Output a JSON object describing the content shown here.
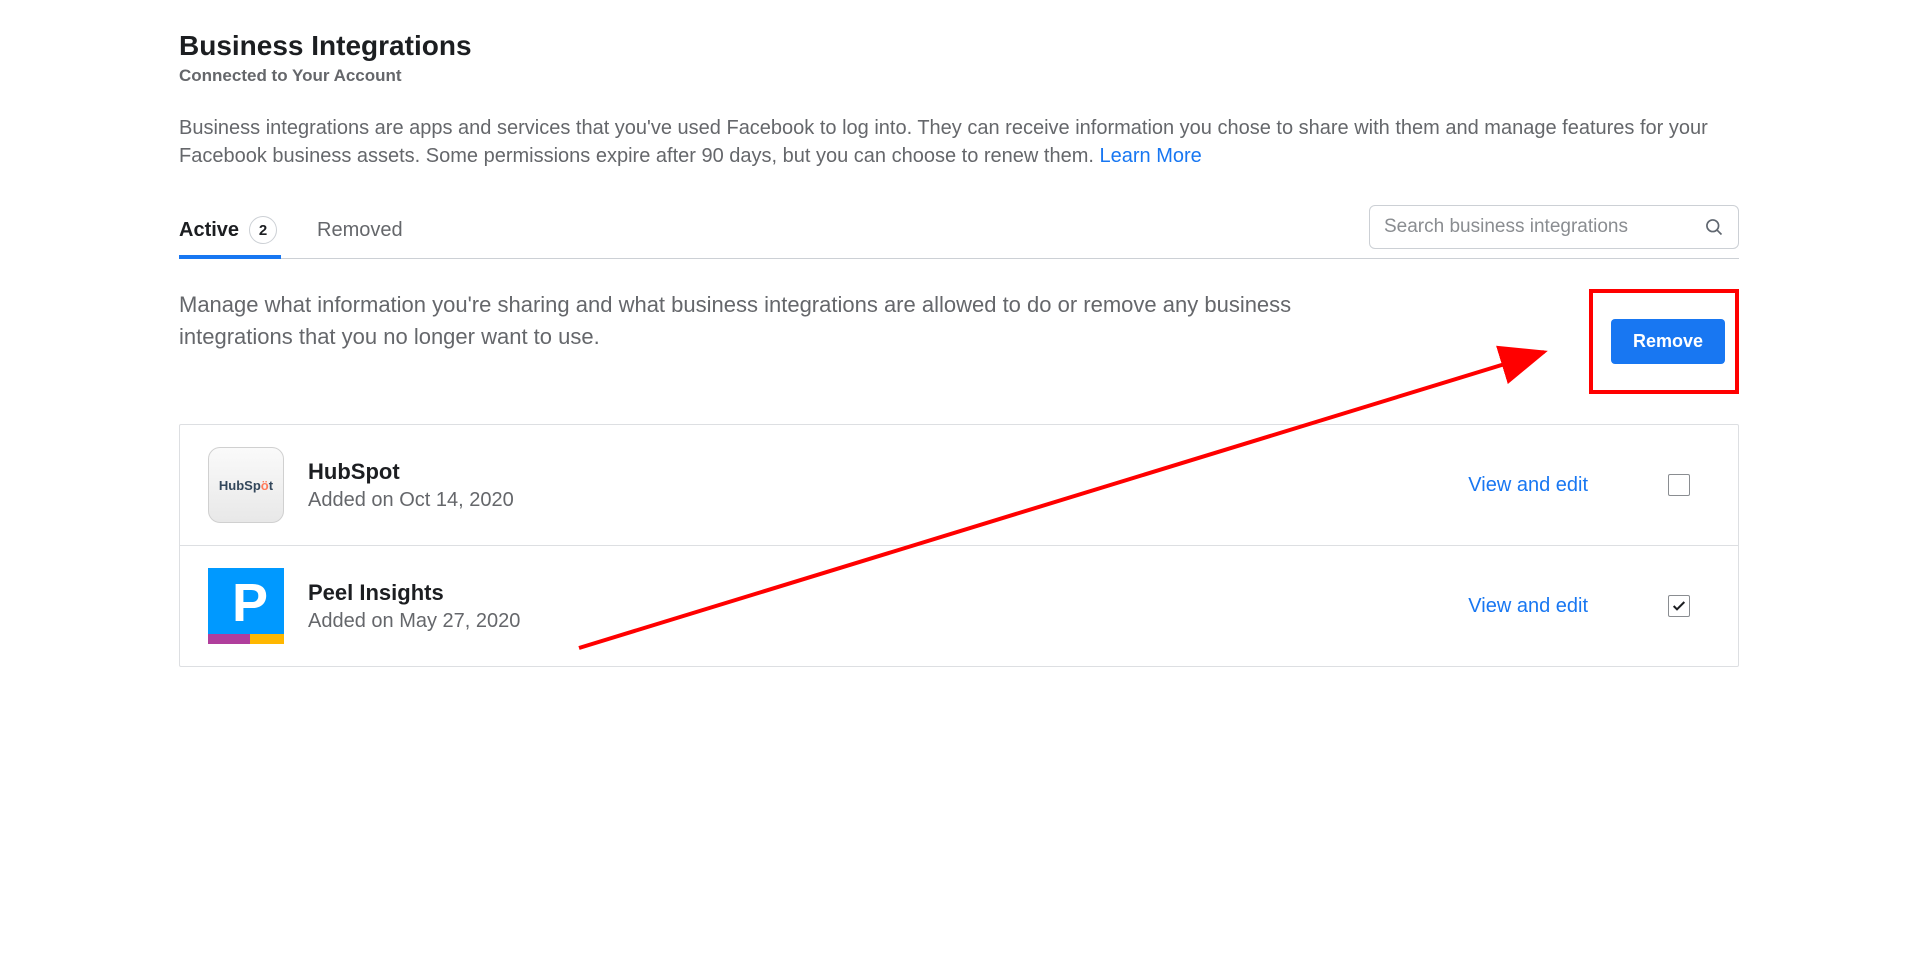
{
  "header": {
    "title": "Business Integrations",
    "subtitle": "Connected to Your Account"
  },
  "description": {
    "text": "Business integrations are apps and services that you've used Facebook to log into. They can receive information you chose to share with them and manage features for your Facebook business assets. Some permissions expire after 90 days, but you can choose to renew them. ",
    "link_text": "Learn More"
  },
  "tabs": {
    "active": {
      "label": "Active",
      "count": "2"
    },
    "removed": {
      "label": "Removed"
    }
  },
  "search": {
    "placeholder": "Search business integrations"
  },
  "manage": {
    "text": "Manage what information you're sharing and what business integrations are allowed to do or remove any business integrations that you no longer want to use.",
    "remove_label": "Remove"
  },
  "integrations": [
    {
      "name": "HubSpot",
      "added": "Added on Oct 14, 2020",
      "action": "View and edit",
      "checked": false,
      "icon": "hubspot"
    },
    {
      "name": "Peel Insights",
      "added": "Added on May 27, 2020",
      "action": "View and edit",
      "checked": true,
      "icon": "peel"
    }
  ]
}
